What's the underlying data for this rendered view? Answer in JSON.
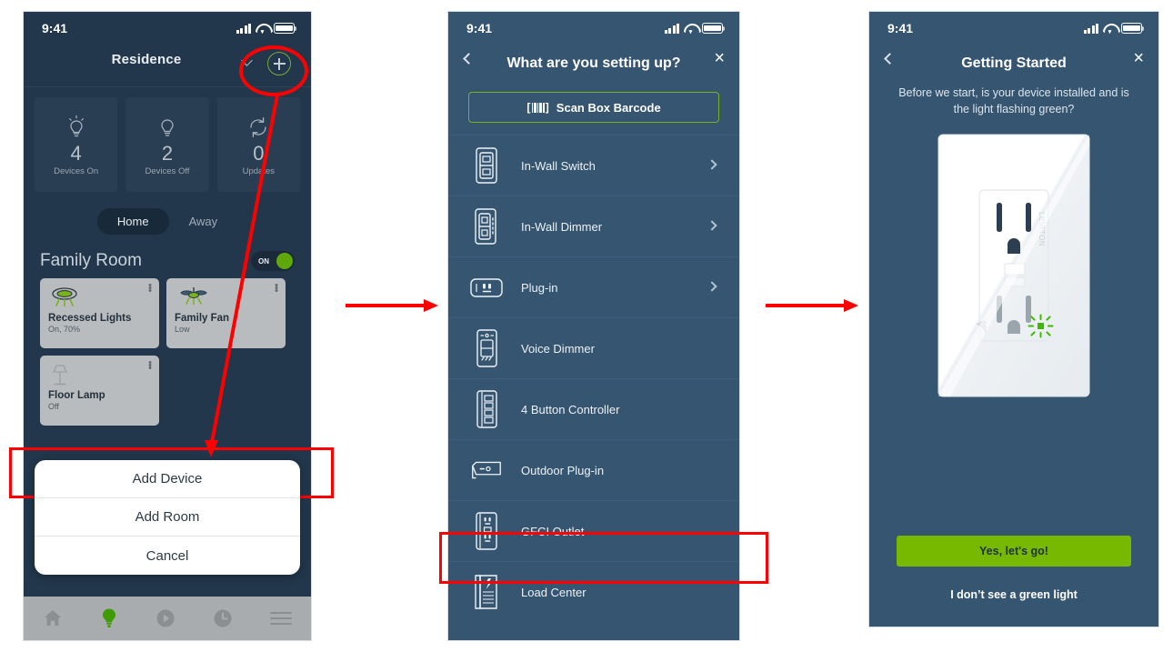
{
  "screens": [
    {
      "id": "home",
      "status": {
        "time": "9:41",
        "signal": "signal-icon",
        "wifi": "wifi-icon",
        "battery": "battery-icon"
      },
      "header": {
        "title": "Residence",
        "caret": "chevron-down-icon",
        "add": "plus-circle-icon"
      },
      "stats": [
        {
          "icon": "bulb-on-icon",
          "value": "4",
          "label": "Devices On"
        },
        {
          "icon": "bulb-off-icon",
          "value": "2",
          "label": "Devices Off"
        },
        {
          "icon": "refresh-icon",
          "value": "0",
          "label": "Updates"
        }
      ],
      "segments": [
        {
          "label": "Home",
          "active": true
        },
        {
          "label": "Away",
          "active": false
        }
      ],
      "room": {
        "name": "Family Room",
        "toggle_label": "ON",
        "toggle_on": true
      },
      "devices": [
        {
          "icon": "recessed-light-icon",
          "name": "Recessed Lights",
          "state": "On, 70%"
        },
        {
          "icon": "ceiling-fan-icon",
          "name": "Family Fan",
          "state": "Low"
        },
        {
          "icon": "floor-lamp-icon",
          "name": "Floor Lamp",
          "state": "Off"
        }
      ],
      "action_sheet": [
        {
          "label": "Add Device",
          "highlighted": true
        },
        {
          "label": "Add Room",
          "highlighted": false
        },
        {
          "label": "Cancel",
          "highlighted": false
        }
      ],
      "tabbar": [
        {
          "icon": "home-icon",
          "active": false
        },
        {
          "icon": "lightbulb-icon",
          "active": true
        },
        {
          "icon": "play-circle-icon",
          "active": false
        },
        {
          "icon": "clock-icon",
          "active": false
        },
        {
          "icon": "menu-icon",
          "active": false
        }
      ]
    },
    {
      "id": "setup-picker",
      "status": {
        "time": "9:41"
      },
      "nav": {
        "back": "chevron-left-icon",
        "title": "What are you setting up?",
        "close": "close-icon"
      },
      "scan_button": {
        "icon": "barcode-icon",
        "label": "Scan Box Barcode"
      },
      "items": [
        {
          "icon": "in-wall-switch-icon",
          "label": "In-Wall Switch",
          "chevron": true
        },
        {
          "icon": "in-wall-dimmer-icon",
          "label": "In-Wall Dimmer",
          "chevron": true
        },
        {
          "icon": "plug-in-icon",
          "label": "Plug-in",
          "chevron": true
        },
        {
          "icon": "voice-dimmer-icon",
          "label": "Voice Dimmer",
          "chevron": false
        },
        {
          "icon": "four-button-controller-icon",
          "label": "4 Button Controller",
          "chevron": false
        },
        {
          "icon": "outdoor-plug-in-icon",
          "label": "Outdoor Plug-in",
          "chevron": false
        },
        {
          "icon": "gfci-outlet-icon",
          "label": "GFCI Outlet",
          "chevron": false,
          "highlighted": true
        },
        {
          "icon": "load-center-icon",
          "label": "Load Center",
          "chevron": false
        }
      ]
    },
    {
      "id": "getting-started",
      "status": {
        "time": "9:41"
      },
      "nav": {
        "back": "chevron-left-icon",
        "title": "Getting Started",
        "close": "close-icon"
      },
      "subtitle": "Before we start, is your device installed and is the light flashing green?",
      "illustration": {
        "name": "smart-outlet-illustration",
        "brand": "LEVITON",
        "indicator": "flashing-green-light"
      },
      "primary_button": "Yes, let's go!",
      "secondary_link": "I don’t see a green light"
    }
  ],
  "annotations": {
    "flow_arrows": 2,
    "highlight_color": "#ff0000",
    "accent_green": "#76b900",
    "phone1_bg": "#22374b",
    "phone23_bg": "#355570"
  }
}
